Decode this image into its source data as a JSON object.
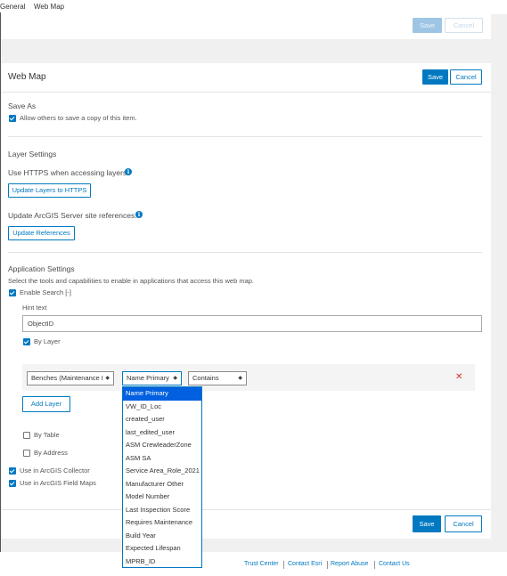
{
  "tabs": [
    "General",
    "Web Map"
  ],
  "general": {
    "save_label": "Save",
    "cancel_label": "Cancel"
  },
  "webmap": {
    "title": "Web Map",
    "save_label": "Save",
    "cancel_label": "Cancel",
    "save_as": {
      "heading": "Save As",
      "allow_copy_label": "Allow others to save a copy of this item.",
      "allow_copy_checked": true
    },
    "layer_settings": {
      "heading": "Layer Settings",
      "https_label": "Use HTTPS when accessing layers.",
      "https_button": "Update Layers to HTTPS",
      "refs_label": "Update ArcGIS Server site references.",
      "refs_button": "Update References"
    },
    "app_settings": {
      "heading": "Application Settings",
      "description": "Select the tools and capabilities to enable in applications that access this web map.",
      "enable_search_label": "Enable Search [-]",
      "enable_search_checked": true,
      "hint_label": "Hint text",
      "hint_value": "ObjectID",
      "by_layer_label": "By Layer",
      "by_layer_checked": true,
      "layer_select": "Benches (Maintenance I",
      "field_select": "Name Primary",
      "operator_select": "Contains",
      "add_layer_button": "Add Layer",
      "by_table_label": "By Table",
      "by_table_checked": false,
      "by_address_label": "By Address",
      "by_address_checked": false,
      "collector_label": "Use in ArcGIS Collector",
      "collector_checked": true,
      "field_maps_label": "Use in ArcGIS Field Maps",
      "field_maps_checked": true
    },
    "field_options": [
      "Name Primary",
      "VW_ID_Loc",
      "created_user",
      "last_edited_user",
      "ASM CrewleaderZone",
      "ASM SA",
      "Service Area_Role_2021",
      "Manufacturer Other",
      "Model Number",
      "Last Inspection Score",
      "Requires Maintenance",
      "Build Year",
      "Expected Lifespan",
      "MPRB_ID"
    ],
    "bottom_save_label": "Save",
    "bottom_cancel_label": "Cancel"
  },
  "footer": {
    "links": [
      "Trust Center",
      "Contact Esri",
      "Report Abuse",
      "Contact Us"
    ]
  },
  "colors": {
    "accent": "#0079c1",
    "selection": "#0060df",
    "danger": "#d83020"
  },
  "icons": {
    "info": "info-icon",
    "remove": "close-icon",
    "select_arrow": "chevron-updown-icon"
  }
}
